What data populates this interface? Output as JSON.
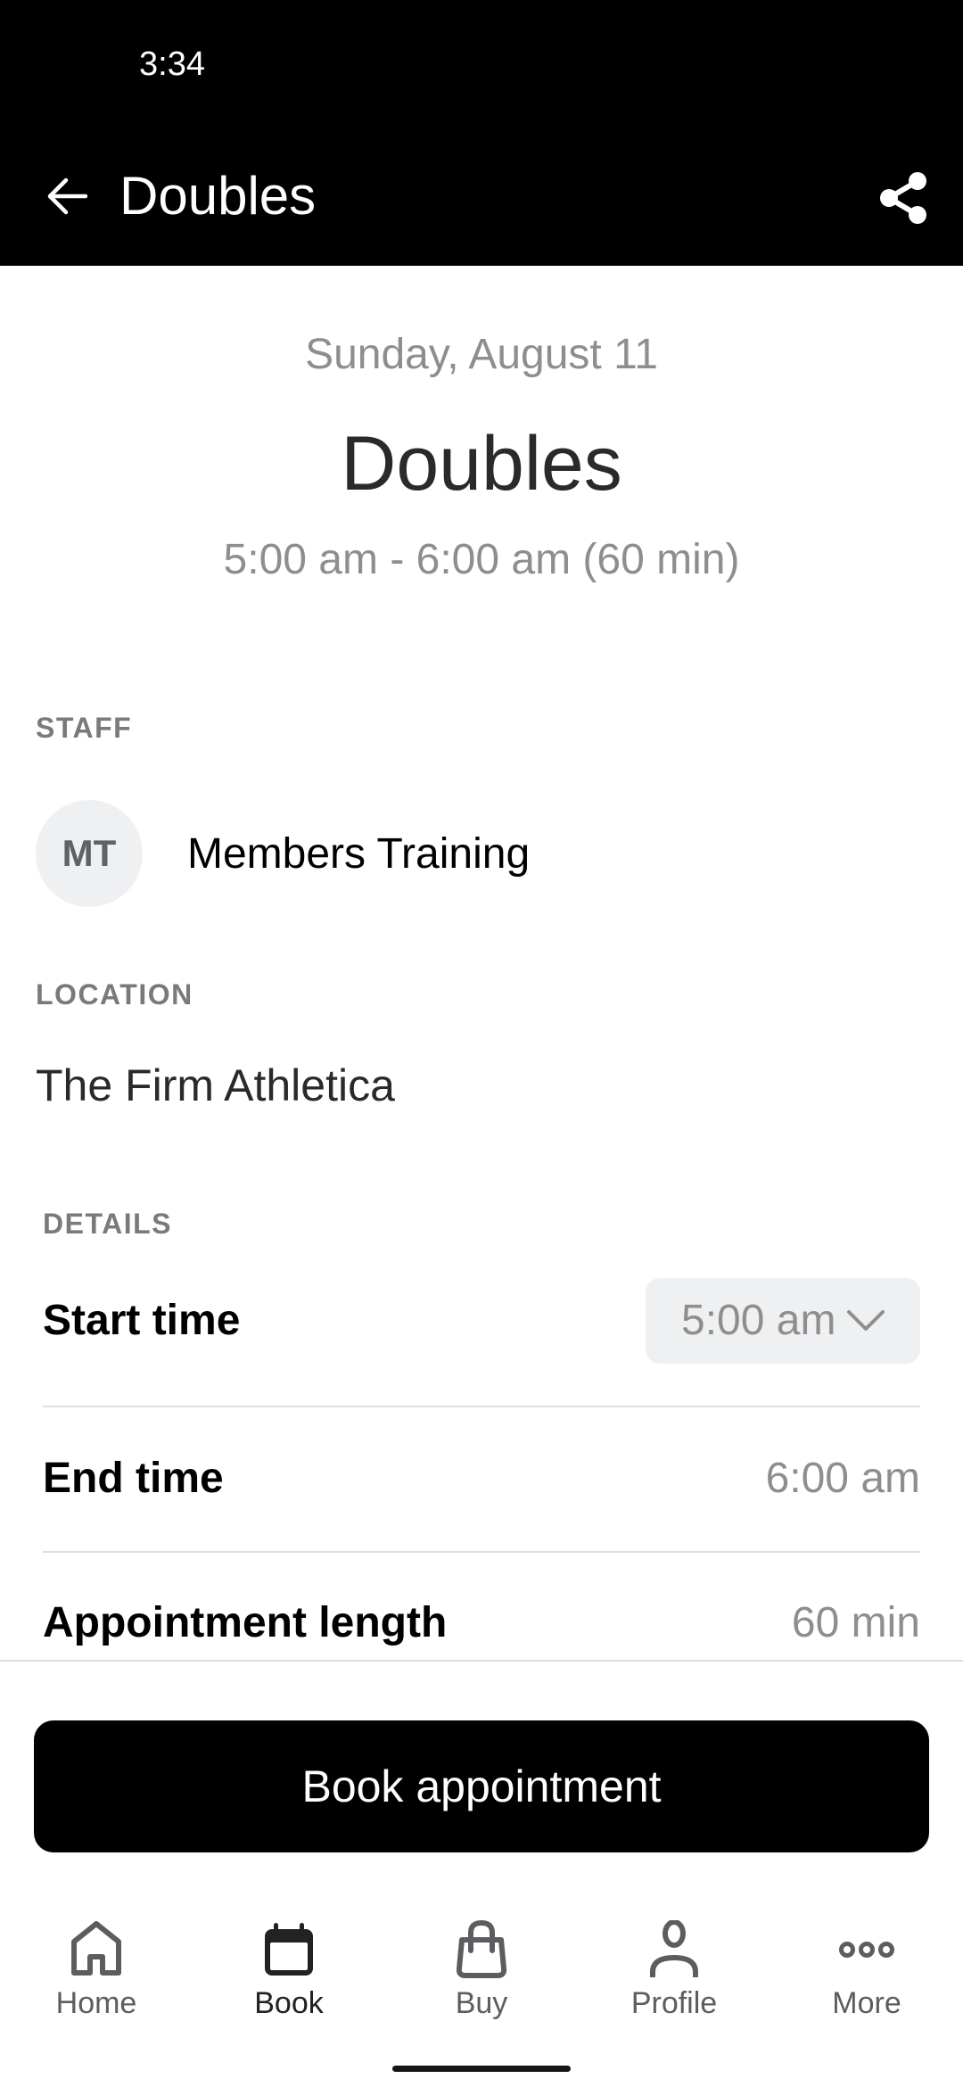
{
  "status_bar": {
    "time": "3:34"
  },
  "app_bar": {
    "title": "Doubles",
    "back_icon": "arrow-back-icon",
    "share_icon": "share-icon"
  },
  "hero": {
    "date": "Sunday, August 11",
    "title": "Doubles",
    "time_range": "5:00 am - 6:00 am (60 min)"
  },
  "staff": {
    "section_label": "STAFF",
    "avatar_initials": "MT",
    "name": "Members Training"
  },
  "location": {
    "section_label": "LOCATION",
    "name": "The Firm Athletica"
  },
  "details": {
    "section_label": "DETAILS",
    "rows": [
      {
        "label": "Start time",
        "value": "5:00 am",
        "type": "dropdown"
      },
      {
        "label": "End time",
        "value": "6:00 am",
        "type": "text"
      },
      {
        "label": "Appointment length",
        "value": "60 min",
        "type": "text"
      }
    ]
  },
  "actions": {
    "book_label": "Book appointment"
  },
  "nav": {
    "active": "Book",
    "items": [
      {
        "label": "Home",
        "icon": "home-icon"
      },
      {
        "label": "Book",
        "icon": "calendar-icon"
      },
      {
        "label": "Buy",
        "icon": "shopping-bag-icon"
      },
      {
        "label": "Profile",
        "icon": "person-icon"
      },
      {
        "label": "More",
        "icon": "more-horizontal-icon"
      }
    ]
  },
  "colors": {
    "header_bg": "#000000",
    "primary_button": "#000000",
    "muted_text": "#8e8e8e",
    "chip_bg": "#eff0f2",
    "nav_icon": "#5c5d61",
    "nav_icon_active": "#222222"
  }
}
